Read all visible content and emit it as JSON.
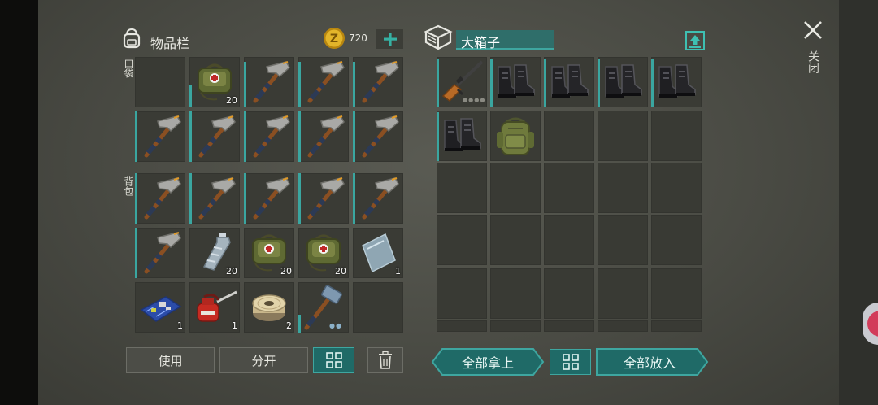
{
  "inventory": {
    "title": "物品栏",
    "coins": "720",
    "pocket_label": "口袋",
    "backpack_label": "背包",
    "pocket_slots": [
      {
        "item": "empty"
      },
      {
        "item": "first-aid-bag",
        "count": "20"
      },
      {
        "item": "pickaxe"
      },
      {
        "item": "pickaxe"
      },
      {
        "item": "pickaxe"
      },
      {
        "item": "pickaxe"
      },
      {
        "item": "pickaxe"
      },
      {
        "item": "pickaxe"
      },
      {
        "item": "pickaxe"
      },
      {
        "item": "pickaxe"
      }
    ],
    "backpack_slots": [
      {
        "item": "pickaxe"
      },
      {
        "item": "pickaxe"
      },
      {
        "item": "pickaxe"
      },
      {
        "item": "pickaxe"
      },
      {
        "item": "pickaxe"
      },
      {
        "item": "pickaxe"
      },
      {
        "item": "water-bottle",
        "count": "20"
      },
      {
        "item": "first-aid-bag",
        "count": "20"
      },
      {
        "item": "first-aid-bag",
        "count": "20"
      },
      {
        "item": "metal-plate",
        "count": "1"
      },
      {
        "item": "circuit-board",
        "count": "1"
      },
      {
        "item": "oil-can",
        "count": "1"
      },
      {
        "item": "wire-spool",
        "count": "2"
      },
      {
        "item": "sledgehammer"
      },
      {
        "item": "empty"
      }
    ],
    "buttons": {
      "use": "使用",
      "split": "分开"
    }
  },
  "container": {
    "title": "大箱子",
    "slots": [
      {
        "item": "rifle"
      },
      {
        "item": "boots"
      },
      {
        "item": "boots"
      },
      {
        "item": "boots"
      },
      {
        "item": "boots"
      },
      {
        "item": "boots"
      },
      {
        "item": "backpack"
      }
    ],
    "buttons": {
      "take_all": "全部拿上",
      "put_all": "全部放入"
    }
  },
  "close_label": "关闭",
  "colors": {
    "accent": "#3ea6a0",
    "button_teal": "#1f6a67",
    "coin": "#e3b52a"
  }
}
